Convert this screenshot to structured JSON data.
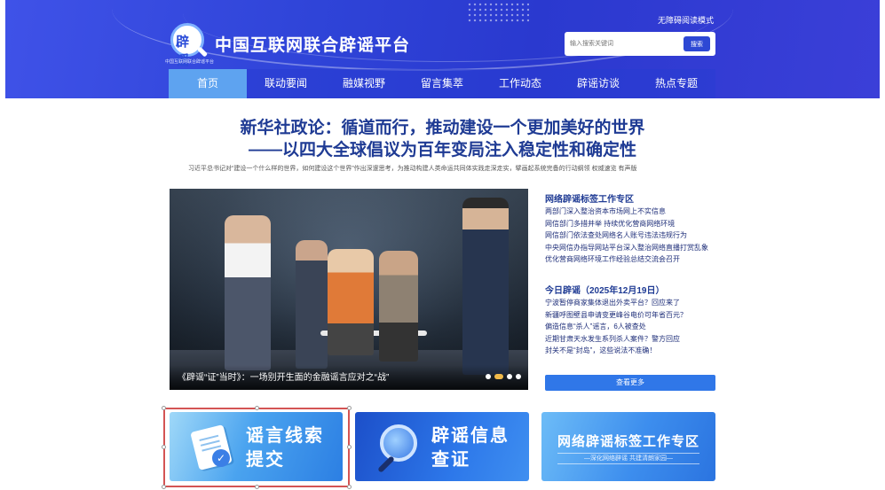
{
  "header": {
    "logo_mark": "辟谣",
    "logo_sub": "中国互联网联合辟谣平台",
    "site_title": "中国互联网联合辟谣平台",
    "barrier_free_link": "无障碍阅读模式",
    "search": {
      "placeholder": "输入搜索关键词",
      "button_label": "搜索"
    },
    "nav": [
      {
        "label": "首页",
        "active": true
      },
      {
        "label": "联动要闻",
        "active": false
      },
      {
        "label": "融媒视野",
        "active": false
      },
      {
        "label": "留言集萃",
        "active": false
      },
      {
        "label": "工作动态",
        "active": false
      },
      {
        "label": "辟谣访谈",
        "active": false
      },
      {
        "label": "热点专题",
        "active": false
      }
    ]
  },
  "headline": {
    "line1": "新华社政论：循道而行，推动建设一个更加美好的世界",
    "line2": "——以四大全球倡议为百年变局注入稳定性和确定性",
    "summary": "习近平总书记对“建设一个什么样的世界，如何建设这个世界”作出深邃思考，为推动构建人类命运共同体实践走深走实，擘画起系统完备的行动纲领  权威速览  有声版"
  },
  "carousel": {
    "caption": "《辟谣“证”当时》：一场别开生面的金融谣言应对之“战”",
    "slide_count": 4,
    "active_slide": 2
  },
  "right_column": {
    "section1_title": "网络辟谣标签工作专区",
    "section1_items": [
      "两部门深入整治资本市场网上不实信息",
      "网信部门多措并举 持续优化营商网络环境",
      "网信部门依法查处网络名人账号违法违规行为",
      "中央网信办指导网站平台深入整治网络直播打赏乱象",
      "优化营商网络环境工作经验总结交流会召开"
    ],
    "section2_title": "今日辟谣（2025年12月19日）",
    "section2_items": [
      "宁波暂停商家集体退出外卖平台？回应来了",
      "新疆呼图壁县申请变更峰谷电价可年省百元？",
      "偏造信息“杀人”谣言，6人被查处",
      "近期甘肃天水发生系列杀人案件？警方回应",
      "封关不是“封岛”，这些说法不准确！"
    ],
    "more_button": "查看更多"
  },
  "banners": {
    "b1_line1": "谣言线索",
    "b1_line2": "提交",
    "b2_line1": "辟谣信息",
    "b2_line2": "查证",
    "b3_title": "网络辟谣标签工作专区",
    "b3_sub": "—深化网络辟谣  共建清朗家园—"
  },
  "icons": {
    "logo": "magnifier-logo-icon",
    "clipboard": "clipboard-check-icon",
    "magnifier": "magnifier-icon"
  },
  "colors": {
    "header_blue": "#2f44d8",
    "nav_active": "#5ea3f0",
    "headline": "#1f3b94",
    "more_button": "#3077e8",
    "selection_border": "#d45454"
  }
}
